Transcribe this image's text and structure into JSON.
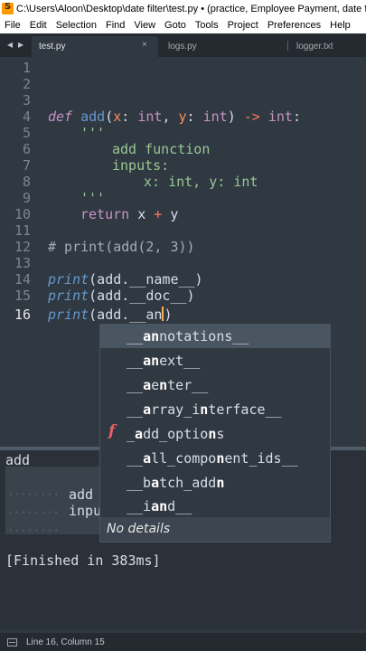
{
  "window": {
    "title": "C:\\Users\\Aloon\\Desktop\\date filter\\test.py • (practice, Employee Payment, date filter, Ra"
  },
  "menu": [
    "File",
    "Edit",
    "Selection",
    "Find",
    "View",
    "Goto",
    "Tools",
    "Project",
    "Preferences",
    "Help"
  ],
  "tabs": [
    {
      "label": "test.py",
      "active": true
    },
    {
      "label": "logs.py",
      "active": false
    },
    {
      "label": "logger.txt",
      "active": false
    }
  ],
  "tab_nav": {
    "prev": "◂",
    "next": "▸",
    "close": "×"
  },
  "editor": {
    "line_numbers": [
      "1",
      "2",
      "3",
      "4",
      "5",
      "6",
      "7",
      "8",
      "9",
      "10",
      "11",
      "12",
      "13",
      "14",
      "15",
      "16"
    ],
    "current_line": "16",
    "code": {
      "l4": {
        "def": "def",
        "name": "add",
        "p1": "x",
        "c1": ": ",
        "t1": "int",
        "sep": ", ",
        "p2": "y",
        "c2": ": ",
        "t2": "int",
        "close": ") ",
        "arrow": "->",
        "rt": " int",
        "colon": ":"
      },
      "l5": "'''",
      "l6": "add function",
      "l7": "inputs:",
      "l8": "x: int, y: int",
      "l9": "'''",
      "l10": {
        "ret": "return",
        "a": " x ",
        "op": "+",
        "b": " y"
      },
      "l12": "# print(add(2, 3))",
      "l14": {
        "fn": "print",
        "rest": "(add.__name__)"
      },
      "l15": {
        "fn": "print",
        "rest": "(add.__doc__)"
      },
      "l16": {
        "fn": "print",
        "rest": "(add.__an",
        "after": ")"
      }
    }
  },
  "autocomplete": {
    "items": [
      {
        "pre": "__",
        "hl": "an",
        "post": "notations__",
        "selected": true
      },
      {
        "pre": "__",
        "hl": "an",
        "post": "ext__",
        "selected": false
      },
      {
        "pre": "__",
        "hl": "a",
        "mid": "e",
        "hl2": "n",
        "post": "ter__",
        "selected": false
      },
      {
        "pre": "__",
        "hl": "a",
        "mid": "rray_i",
        "hl2": "n",
        "post": "terface__",
        "selected": false
      },
      {
        "pre": "_",
        "hl": "a",
        "mid": "dd_optio",
        "hl2": "n",
        "post": "s",
        "kind": "f",
        "selected": false
      },
      {
        "pre": "__",
        "hl": "a",
        "mid": "ll_compo",
        "hl2": "n",
        "post": "ent_ids__",
        "selected": false
      },
      {
        "pre": "__b",
        "hl": "a",
        "mid": "tch_add",
        "hl2": "n",
        "post": "",
        "selected": false
      },
      {
        "pre": "__i",
        "hl": "an",
        "post": "d__",
        "selected": false
      }
    ],
    "details": "No details"
  },
  "output": {
    "line1": "add",
    "line2": "add",
    "line3": "inpu",
    "finished": "[Finished in 383ms]"
  },
  "status": {
    "position": "Line 16, Column 15"
  }
}
